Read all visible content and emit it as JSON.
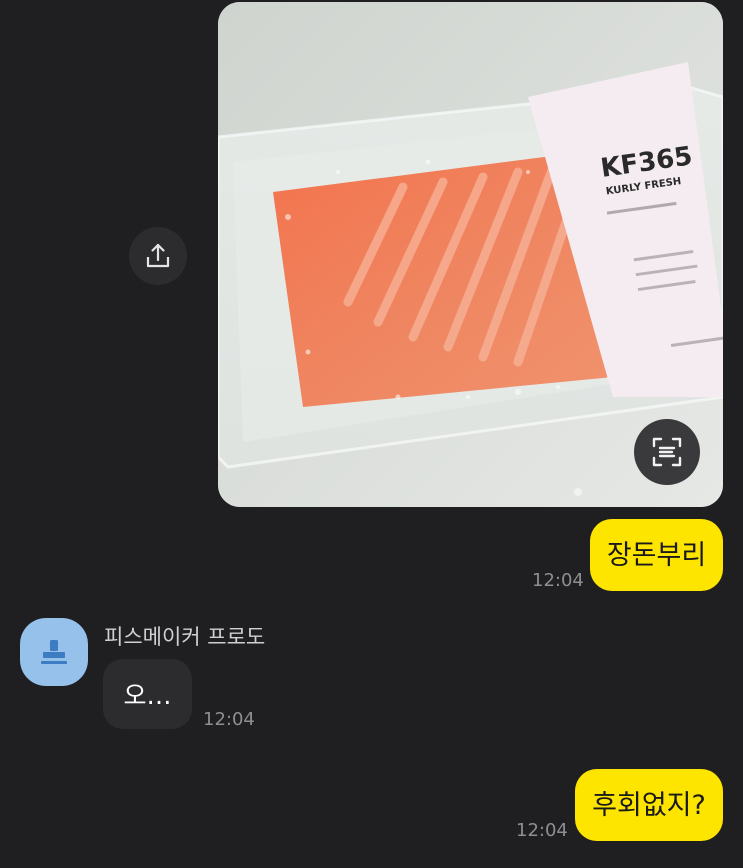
{
  "photo": {
    "brand_title": "KF365",
    "brand_subtitle": "KURLY FRESH"
  },
  "messages": [
    {
      "text": "장돈부리",
      "time": "12:04"
    },
    {
      "sender": "피스메이커 프로도",
      "text": "오…",
      "time": "12:04"
    },
    {
      "text": "후회없지?",
      "time": "12:04"
    }
  ],
  "icons": {
    "share": "share-icon",
    "ocr": "text-scan-icon",
    "avatar": "default-profile-icon"
  },
  "colors": {
    "background": "#1f1f21",
    "my_bubble": "#fee500",
    "their_bubble": "#2c2c2e",
    "avatar": "#96c1ea",
    "timestamp": "#8e8e93"
  }
}
